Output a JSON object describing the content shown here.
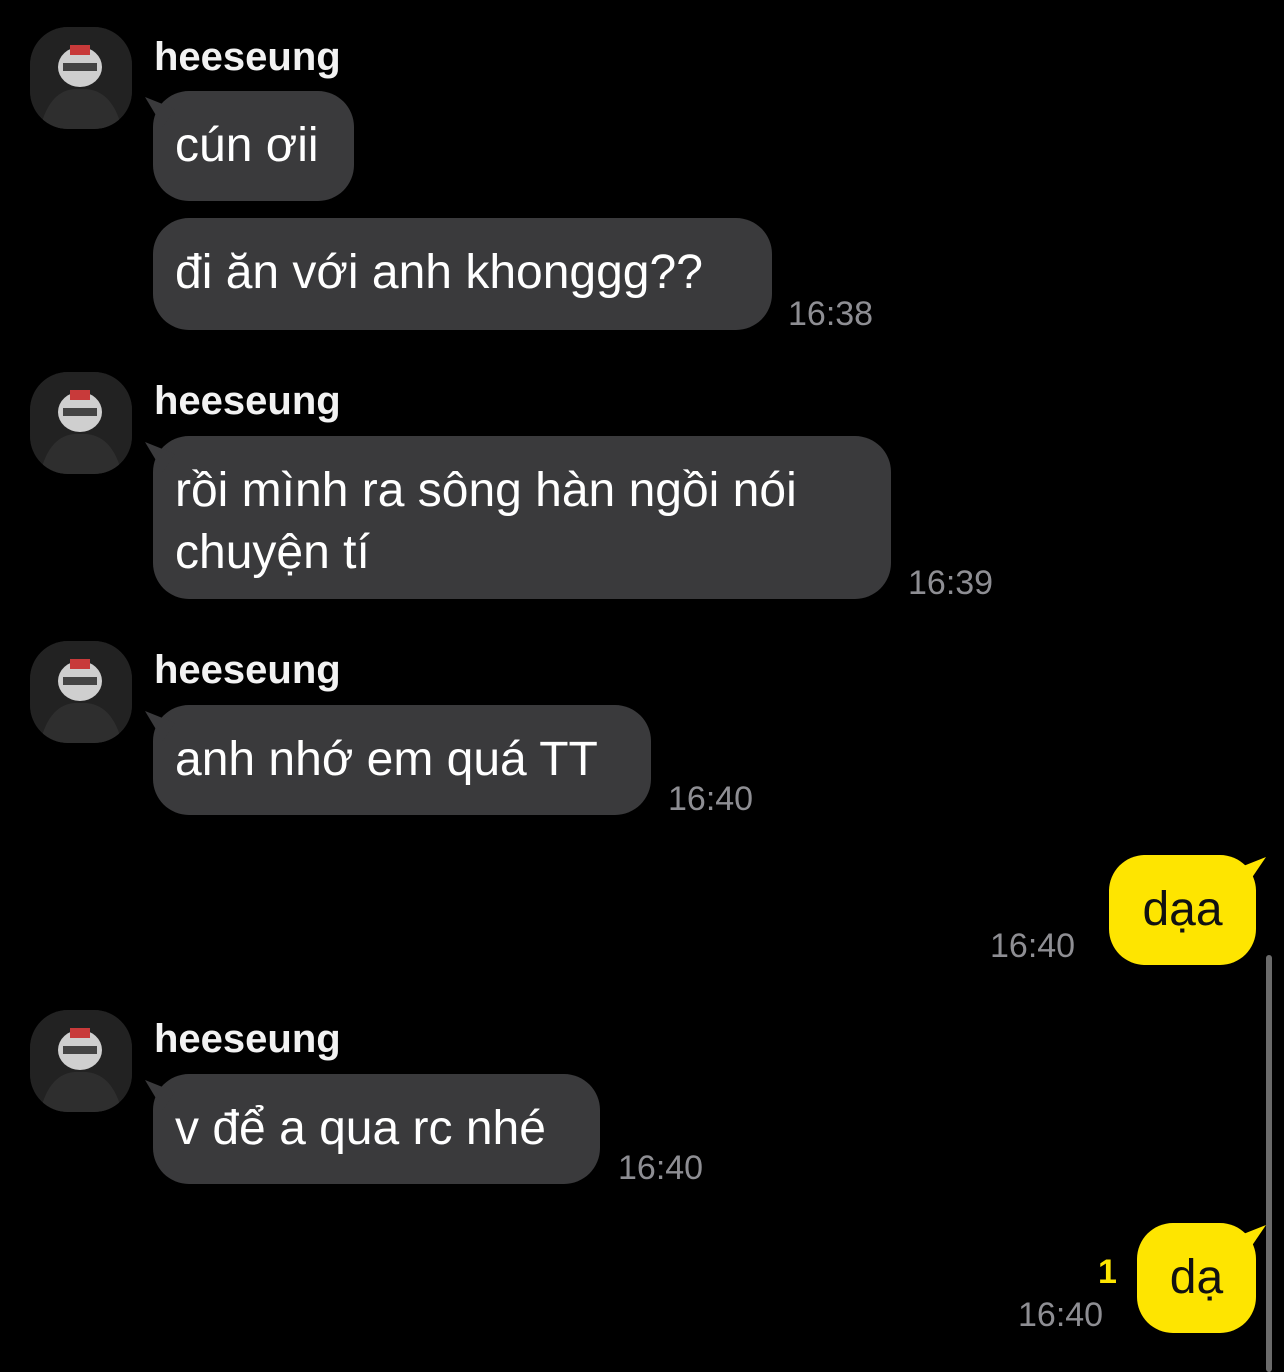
{
  "messages": [
    {
      "sender": "heeseung",
      "bubbles": [
        "cún ơii",
        "đi ăn với anh khonggg??"
      ],
      "time": "16:38"
    },
    {
      "sender": "heeseung",
      "bubbles": [
        "rồi mình ra sông hàn ngồi nói chuyện tí"
      ],
      "time": "16:39"
    },
    {
      "sender": "heeseung",
      "bubbles": [
        "anh nhớ em quá TT"
      ],
      "time": "16:40"
    },
    {
      "mine": true,
      "bubbles": [
        "dạa"
      ],
      "time": "16:40"
    },
    {
      "sender": "heeseung",
      "bubbles": [
        "v để a qua rc nhé"
      ],
      "time": "16:40"
    },
    {
      "mine": true,
      "bubbles": [
        "dạ"
      ],
      "time": "16:40",
      "unread": "1"
    }
  ],
  "colors": {
    "background": "#000000",
    "incoming_bubble": "#3a3a3c",
    "outgoing_bubble": "#fee500",
    "timestamp": "#8e8e93"
  },
  "icons": {
    "avatar": "profile-photo"
  }
}
